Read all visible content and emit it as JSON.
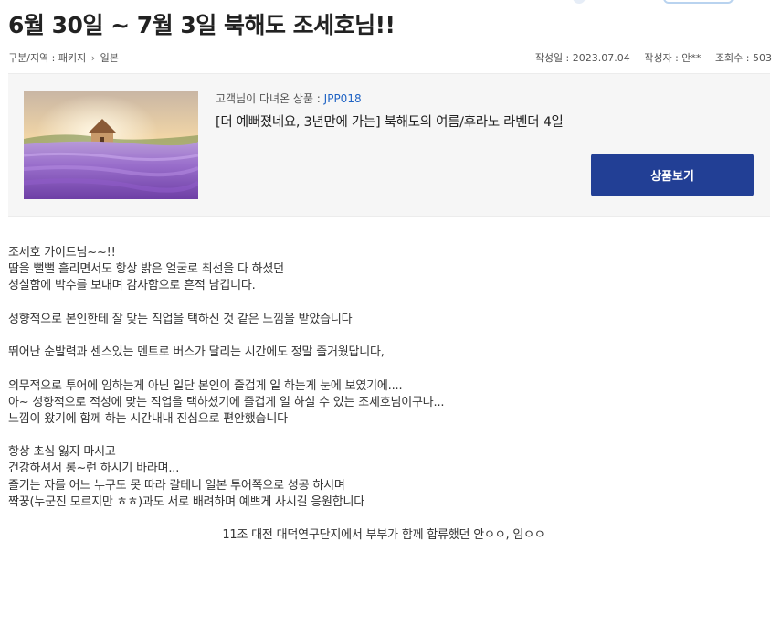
{
  "post": {
    "title": "6월 30일 ~ 7월 3일 북해도 조세호님!!"
  },
  "breadcrumb": {
    "label": "구분/지역 : 패키지",
    "separator": "›",
    "region": "일본"
  },
  "info": {
    "date": "작성일 : 2023.07.04",
    "author": "작성자 : 안**",
    "views": "조회수 : 503"
  },
  "product": {
    "code_label": "고객님이 다녀온 상품 : ",
    "code": "JPP018",
    "name": "[더 예뻐졌네요, 3년만에 가는] 북해도의 여름/후라노 라벤더 4일",
    "button_label": "상품보기",
    "image_icon": "lavender-field-photo"
  },
  "content": {
    "lines": [
      "조세호 가이드님~~!!",
      "땀을 뻘뻘 흘리면서도 항상 밝은 얼굴로 최선을 다 하셨던",
      "성실함에 박수를 보내며 감사함으로 흔적 남깁니다.",
      "",
      "성향적으로 본인한테 잘 맞는 직업을 택하신 것 같은 느낌을 받았습니다",
      "",
      " 뛰어난 순발력과 센스있는 멘트로 버스가 달리는 시간에도 정말 즐거웠답니다,",
      "",
      " 의무적으로 투어에 임하는게 아닌 일단 본인이 즐겁게 일 하는게 눈에 보였기에....",
      "아~ 성향적으로 적성에 맞는 직업을 택하셨기에 즐겁게 일 하실 수 있는 조세호님이구나...",
      "느낌이 왔기에 함께 하는 시간내내 진심으로 편안했습니다",
      "",
      "항상 초심 잃지 마시고",
      "건강하셔서 롱~런 하시기 바라며...",
      "즐기는 자를 어느 누구도 못 따라 갈테니 일본 투어쪽으로 성공 하시며",
      "짝꿍(누군진 모르지만 ㅎㅎ)과도 서로 배려하며 예쁘게 사시길 응원합니다",
      "",
      "11조 대전 대덕연구단지에서 부부가 함께 합류했던  안ㅇㅇ, 임ㅇㅇ"
    ]
  },
  "colors": {
    "accent_blue": "#1f63c4",
    "button_bg": "#223f95",
    "panel_bg": "#f6f6f6"
  }
}
